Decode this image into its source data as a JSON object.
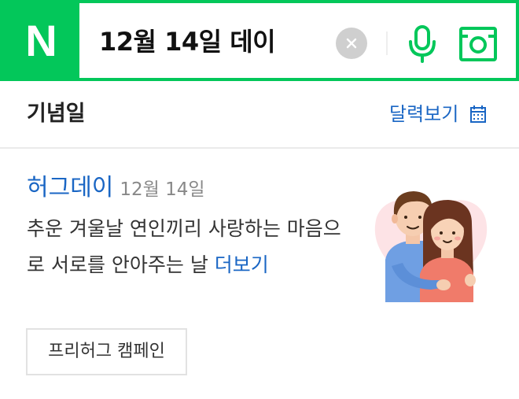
{
  "search": {
    "logo_text": "N",
    "query": "12월 14일 데이",
    "colors": {
      "brand": "#03c75a",
      "clear_button": "#cfcfcf"
    },
    "icons": [
      "clear-icon",
      "microphone-icon",
      "smart-lens-icon"
    ]
  },
  "section": {
    "title": "기념일",
    "calendar_label": "달력보기",
    "calendar_icon": "calendar-icon"
  },
  "event": {
    "name": "허그데이",
    "date": "12월 14일",
    "description": "추운 겨울날 연인끼리 사랑하는 마음으로 서로를 안아주는 날",
    "more_label": "더보기",
    "illustration": "hugging-couple-illustration",
    "link_color": "#1a66c4"
  },
  "campaign_button": {
    "label": "프리허그 캠페인"
  }
}
